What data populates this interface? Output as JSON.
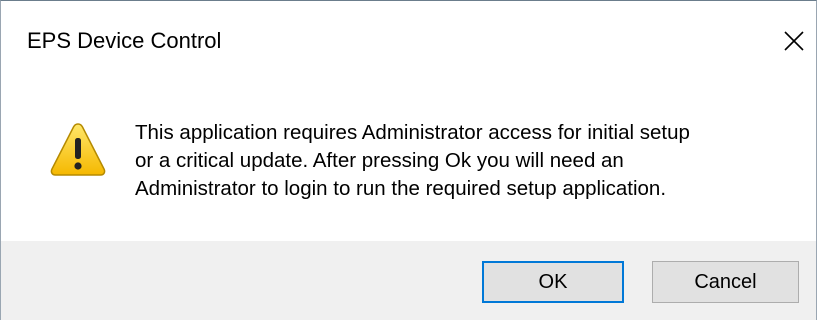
{
  "window": {
    "title": "EPS Device Control",
    "close_icon": "close-icon"
  },
  "dialog": {
    "icon": "warning-icon",
    "message_lines": [
      "This application requires Administrator access for initial setup",
      "or a critical update. After pressing Ok you will need an",
      "Administrator to login to run the required setup application."
    ]
  },
  "buttons": {
    "ok_label": "OK",
    "cancel_label": "Cancel"
  },
  "colors": {
    "accent": "#0078d7",
    "footer_bg": "#f0f0f0",
    "button_bg": "#e1e1e1",
    "warning_yellow": "#ffd21e"
  }
}
